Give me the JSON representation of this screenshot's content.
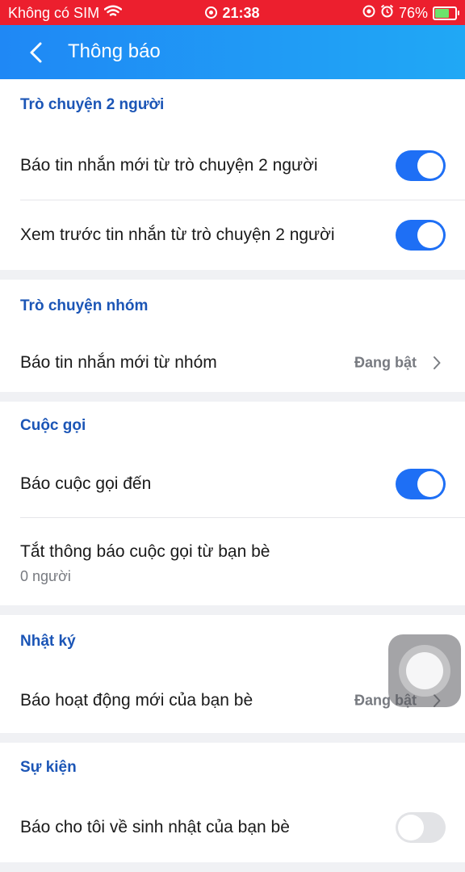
{
  "status_bar": {
    "carrier": "Không có SIM",
    "time": "21:38",
    "battery": "76%",
    "battery_level": 0.76
  },
  "header": {
    "title": "Thông báo"
  },
  "sections": [
    {
      "title": "Trò chuyện 2 người",
      "rows": [
        {
          "label": "Báo tin nhắn mới từ trò chuyện 2 người",
          "toggle": true
        },
        {
          "label": "Xem trước tin nhắn từ trò chuyện 2 người",
          "toggle": true
        }
      ]
    },
    {
      "title": "Trò chuyện nhóm",
      "rows": [
        {
          "label": "Báo tin nhắn mới từ nhóm",
          "value": "Đang bật"
        }
      ]
    },
    {
      "title": "Cuộc gọi",
      "rows": [
        {
          "label": "Báo cuộc gọi đến",
          "toggle": true
        },
        {
          "label": "Tắt thông báo cuộc gọi từ bạn bè",
          "sub": "0 người"
        }
      ]
    },
    {
      "title": "Nhật ký",
      "rows": [
        {
          "label": "Báo hoạt động mới của bạn bè",
          "value": "Đang bật"
        }
      ]
    },
    {
      "title": "Sự kiện",
      "rows": [
        {
          "label": "Báo cho tôi về sinh nhật của bạn bè",
          "toggle": false
        }
      ]
    }
  ],
  "colors": {
    "status_bar": "#ec1f2e",
    "header_gradient_start": "#1f88f5",
    "header_gradient_end": "#20a8f5",
    "section_title": "#1b55b6",
    "toggle_on": "#1e6ff5",
    "toggle_off": "#e2e3e6"
  },
  "icons": [
    "wifi-icon",
    "screen-record-icon",
    "alarm-icon",
    "battery-icon",
    "back-chevron-icon",
    "chevron-right-icon",
    "assistive-touch-icon"
  ]
}
